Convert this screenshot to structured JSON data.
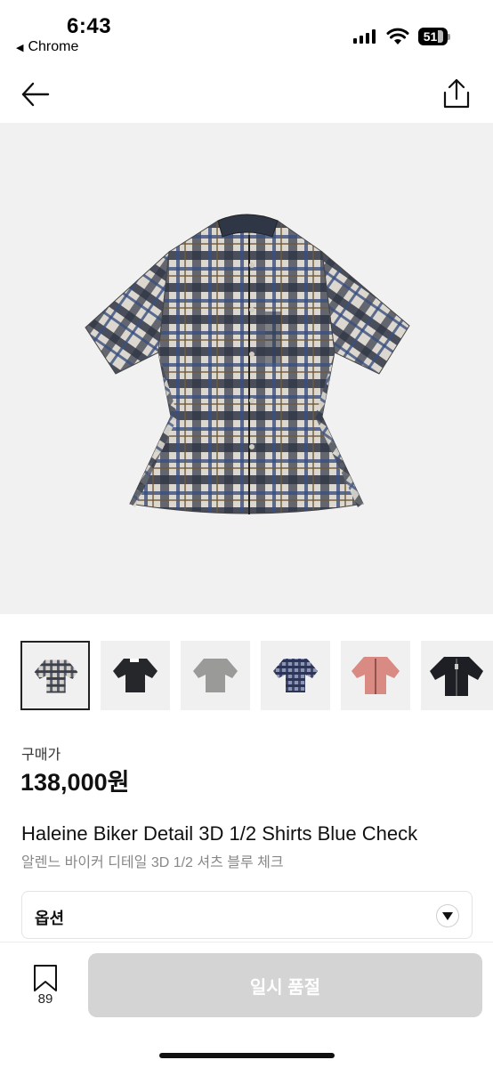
{
  "status_bar": {
    "time": "6:43",
    "back_app": "Chrome",
    "battery_level": "51"
  },
  "hero": {
    "image_alt": "Blue check short sleeve shirt",
    "colors": {
      "dark": "#2f3645",
      "navy": "#3a4f80",
      "light": "#dcd8cf",
      "brown": "#6f5a3a"
    }
  },
  "thumbnails": [
    {
      "variant": "blue-check",
      "color": "#6b6e75",
      "selected": true
    },
    {
      "variant": "black",
      "color": "#25272b",
      "selected": false
    },
    {
      "variant": "grey",
      "color": "#9a9a98",
      "selected": false
    },
    {
      "variant": "navy-check",
      "color": "#3b4870",
      "selected": false
    },
    {
      "variant": "pink",
      "color": "#d98a82",
      "selected": false
    },
    {
      "variant": "black-zip",
      "color": "#1d1f24",
      "selected": false
    }
  ],
  "price": {
    "label": "구매가",
    "value": "138,000원"
  },
  "product": {
    "title_en": "Haleine Biker Detail 3D 1/2 Shirts Blue Check",
    "title_ko": "알렌느 바이커 디테일 3D 1/2 셔츠 블루 체크"
  },
  "option": {
    "label": "옵션"
  },
  "bottom": {
    "bookmark_count": "89",
    "button_label": "일시 품절"
  }
}
